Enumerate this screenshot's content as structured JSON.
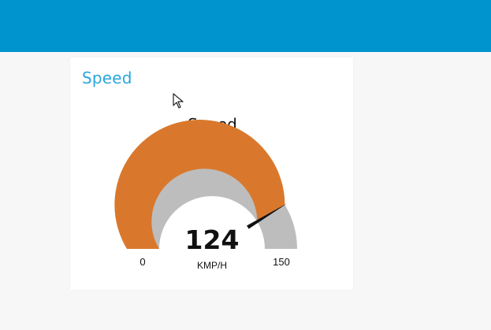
{
  "group": {
    "title": "Speed"
  },
  "gauge": {
    "title": "Speed",
    "value": 124,
    "min": 0,
    "max": 150,
    "units": "KMP/H",
    "min_label": "0",
    "max_label": "150",
    "value_label": "124"
  },
  "colors": {
    "header": "#0094ce",
    "group_title": "#2aa6dd",
    "gauge_fill": "#d9782c",
    "gauge_track": "#bdbdbd",
    "needle": "#111111"
  }
}
